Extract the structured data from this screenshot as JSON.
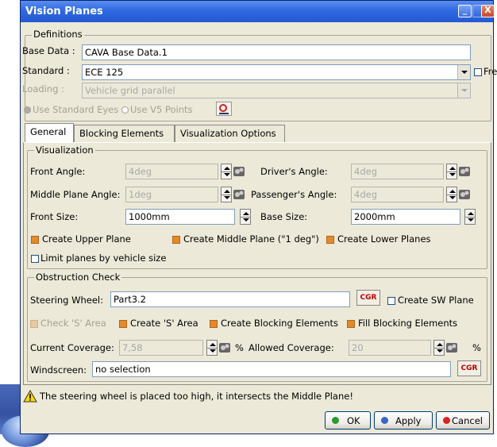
{
  "window": {
    "title": "Vision Planes",
    "minimize": "_",
    "close": "X"
  },
  "definitions": {
    "legend": "Definitions",
    "base_data_label": "Base Data :",
    "base_data_value": "CAVA Base Data.1",
    "standard_label": "Standard :",
    "standard_value": "ECE 125",
    "free_label": "Free",
    "loading_label": "Loading :",
    "loading_value": "Vehicle grid parallel",
    "radio_standard_eyes": "Use Standard Eyes",
    "radio_v5_points": "Use V5 Points"
  },
  "tabs": [
    "General",
    "Blocking Elements",
    "Visualization Options"
  ],
  "visualization": {
    "legend": "Visualization",
    "front_angle_label": "Front Angle:",
    "front_angle_value": "4deg",
    "drivers_angle_label": "Driver's Angle:",
    "drivers_angle_value": "4deg",
    "middle_plane_angle_label": "Middle Plane Angle:",
    "middle_plane_angle_value": "1deg",
    "passengers_angle_label": "Passenger's Angle:",
    "passengers_angle_value": "4deg",
    "front_size_label": "Front Size:",
    "front_size_value": "1000mm",
    "base_size_label": "Base Size:",
    "base_size_value": "2000mm",
    "create_upper_plane": "Create Upper Plane",
    "create_middle_plane": "Create Middle Plane (\"1 deg\")",
    "create_lower_planes": "Create Lower Planes",
    "limit_planes": "Limit planes by vehicle size"
  },
  "obstruction": {
    "legend": "Obstruction Check",
    "steering_wheel_label": "Steering Wheel:",
    "steering_wheel_value": "Part3.2",
    "cgr": "CGR",
    "create_sw_plane": "Create SW Plane",
    "check_s_area": "Check 'S' Area",
    "create_s_area": "Create 'S' Area",
    "create_blocking": "Create Blocking Elements",
    "fill_blocking": "Fill Blocking Elements",
    "current_coverage_label": "Current Coverage:",
    "current_coverage_value": "7,58",
    "percent": "%",
    "allowed_coverage_label": "Allowed Coverage:",
    "allowed_coverage_value": "20",
    "windscreen_label": "Windscreen:",
    "windscreen_value": "no selection"
  },
  "warning": "The steering wheel is placed too high, it intersects the Middle Plane!",
  "buttons": {
    "ok": "OK",
    "apply": "Apply",
    "cancel": "Cancel"
  },
  "colors": {
    "title_bar": "#2f69e0",
    "dialog_bg": "#ece9d8",
    "checkbox_orange": "#e28a2a",
    "ok_green": "#2c9a2c",
    "cancel_red": "#d22"
  }
}
